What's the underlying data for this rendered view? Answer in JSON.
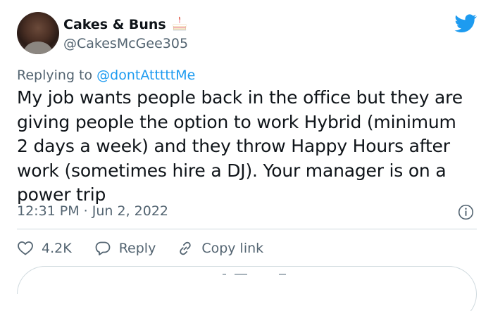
{
  "author": {
    "display_name": "Cakes & Buns",
    "handle": "@CakesMcGee305"
  },
  "reply_context": {
    "prefix": "Replying to",
    "mention": "@dontAtttttMe"
  },
  "tweet": {
    "text": "My job wants people back in the office but they are giving people the option to work Hybrid (minimum 2 days a week) and they throw Happy Hours after work (sometimes hire a DJ). Your manager is on a power trip",
    "timestamp": "12:31 PM · Jun 2, 2022"
  },
  "actions": {
    "like_count": "4.2K",
    "reply_label": "Reply",
    "copy_link_label": "Copy link"
  },
  "colors": {
    "twitter_blue": "#1d9bf0",
    "secondary_text": "#536471",
    "border": "#cfd9de"
  },
  "icons": [
    "cake-emoji-icon",
    "twitter-bird-icon",
    "info-icon",
    "heart-icon",
    "reply-bubble-icon",
    "link-icon"
  ]
}
